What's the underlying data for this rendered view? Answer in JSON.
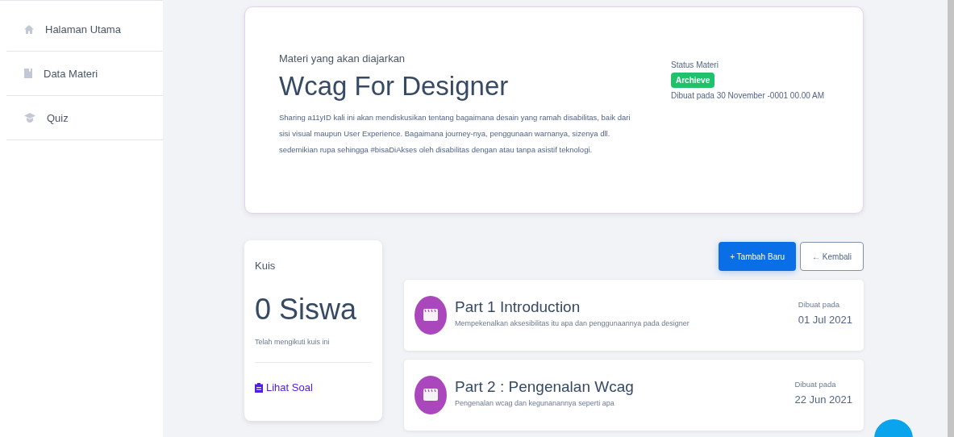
{
  "sidebar": {
    "items": [
      {
        "kind": "home",
        "label": "Halaman Utama",
        "selected": false
      },
      {
        "kind": "book",
        "label": "Data Materi",
        "selected": false
      },
      {
        "kind": "cap",
        "label": "Quiz",
        "selected": false
      }
    ]
  },
  "materi": {
    "subtitle": "Materi yang akan diajarkan",
    "title": "Wcag For Designer",
    "description": "Sharing a11yID kali ini akan mendiskusikan tentang bagaimana desain yang ramah disabilitas, baik dari sisi visual maupun User Experience. Bagaimana journey-nya, penggunaan warnanya, sizenya dll. sedemikian rupa sehingga #bisaDiAkses oleh disabilitas dengan atau tanpa asistif teknologi.",
    "status_label": "Status Materi",
    "status": "Archieve",
    "created": "Dibuat pada 30 November -0001 00.00 AM"
  },
  "quiz": {
    "title": "Kuis",
    "count": "0 Siswa",
    "caption": "Telah mengikuti kuis ini",
    "link": "Lihat Soal"
  },
  "buttons": [
    {
      "kind": "primary",
      "label": "+ Tambah Baru"
    },
    {
      "kind": "outline",
      "label": "← Kembali"
    }
  ],
  "parts": [
    {
      "title": "Part 1 Introduction",
      "description": "Mempekenalkan aksesibilitas itu apa dan penggunaannya pada designer",
      "date_label": "Dibuat pada",
      "date": "01 Jul 2021"
    },
    {
      "title": "Part 2 : Pengenalan Wcag",
      "description": "Pengenalan  wcag dan kegunanannya seperti apa",
      "date_label": "Dibuat pada",
      "date": "22 Jun 2021"
    }
  ]
}
